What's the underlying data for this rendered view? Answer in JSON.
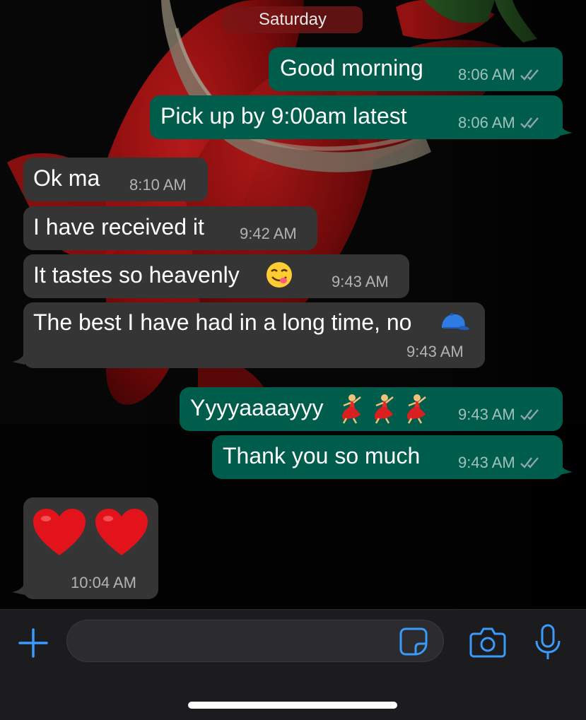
{
  "chat": {
    "day_separator": "Saturday",
    "messages": [
      {
        "direction": "outgoing",
        "text": "Good morning",
        "time": "8:06 AM",
        "status": "read"
      },
      {
        "direction": "outgoing",
        "text": "Pick up by 9:00am latest",
        "time": "8:06 AM",
        "status": "read"
      },
      {
        "direction": "incoming",
        "text": "Ok ma",
        "time": "8:10 AM"
      },
      {
        "direction": "incoming",
        "text": "I have received it",
        "time": "9:42 AM"
      },
      {
        "direction": "incoming",
        "text": "It tastes so heavenly",
        "emoji": "face-savoring-food",
        "time": "9:43 AM"
      },
      {
        "direction": "incoming",
        "text": "The best I have had in a long time, no",
        "emoji": "cap",
        "time": "9:43 AM"
      },
      {
        "direction": "outgoing",
        "text": "Yyyyaaaayyy",
        "emoji": "woman-dancing x3",
        "time": "9:43 AM",
        "status": "read"
      },
      {
        "direction": "outgoing",
        "text": "Thank you so much",
        "time": "9:43 AM",
        "status": "read"
      },
      {
        "direction": "incoming",
        "text": "",
        "emoji": "red-heart x2",
        "time": "10:04 AM"
      }
    ]
  },
  "composer": {
    "placeholder": "",
    "value": "",
    "icons": {
      "attach": "plus-icon",
      "sticker": "sticker-icon",
      "camera": "camera-icon",
      "mic": "microphone-icon"
    }
  },
  "colors": {
    "outgoing_bubble": "#005c4b",
    "incoming_bubble": "#353536",
    "accent": "#3a9bfd",
    "read_ticks": "#8fa3b0"
  }
}
